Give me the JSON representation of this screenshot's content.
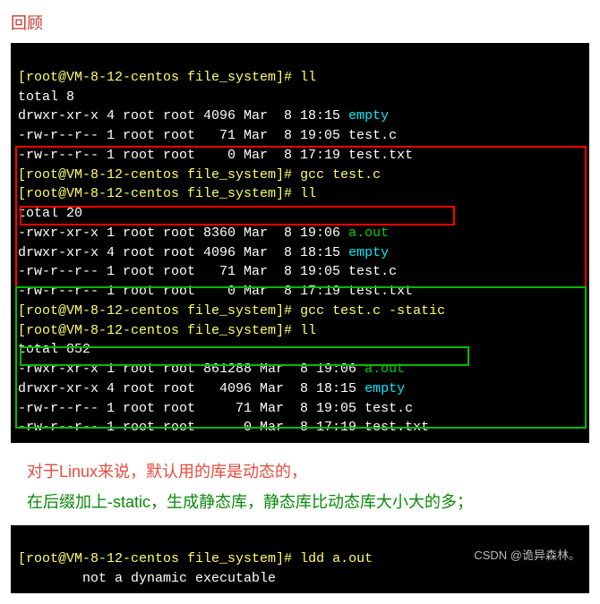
{
  "heading": "回顾",
  "prompt": "[root@VM-8-12-centos file_system]#",
  "cmds": {
    "ll": "ll",
    "gcc": "gcc test.c",
    "gcc_static": "gcc test.c -static",
    "ldd": "ldd a.out"
  },
  "section1": {
    "total": "total 8",
    "l1_perm": "drwxr-xr-x 4 root root 4096 Mar  8 18:15 ",
    "l1_name": "empty",
    "l2": "-rw-r--r-- 1 root root   71 Mar  8 19:05 test.c",
    "l3": "-rw-r--r-- 1 root root    0 Mar  8 17:19 test.txt"
  },
  "section2": {
    "total": "total 20",
    "a_perm": "-rwxr-xr-x 1 root root 8360 Mar  8 19:06 ",
    "a_name": "a.out",
    "l1_perm": "drwxr-xr-x 4 root root 4096 Mar  8 18:15 ",
    "l1_name": "empty",
    "l2": "-rw-r--r-- 1 root root   71 Mar  8 19:05 test.c",
    "l3": "-rw-r--r-- 1 root root    0 Mar  8 17:19 test.txt"
  },
  "section3": {
    "total": "total 852",
    "a_perm": "-rwxr-xr-x 1 root root 861288 Mar  8 19:06 ",
    "a_name": "a.out",
    "l1_perm": "drwxr-xr-x 4 root root   4096 Mar  8 18:15 ",
    "l1_name": "empty",
    "l2": "-rw-r--r-- 1 root root     71 Mar  8 19:05 test.c",
    "l3": "-rw-r--r-- 1 root root      0 Mar  8 17:19 test.txt"
  },
  "note_red": "对于Linux来说，默认用的库是动态的，",
  "note_green": "在后缀加上-static，生成静态库，静态库比动态库大小大的多；",
  "ldd_out": "        not a dynamic executable",
  "watermark": "CSDN @诡异森林。"
}
